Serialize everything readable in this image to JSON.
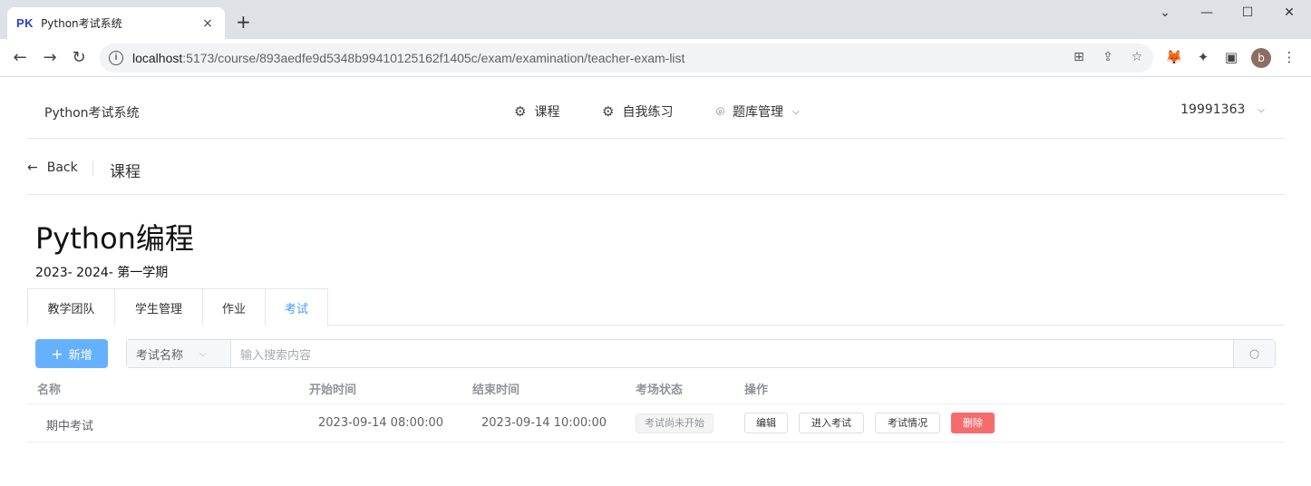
{
  "browser": {
    "tab_favicon": "PK",
    "tab_title": "Python考试系统",
    "tab_close": "×",
    "new_tab": "+",
    "url_host": "localhost",
    "url_path": ":5173/course/893aedfe9d5348b99410125162f1405c/exam/examination/teacher-exam-list",
    "profile_initial": "b"
  },
  "header": {
    "brand": "Python考试系统",
    "nav": [
      {
        "label": "课程",
        "icon": "gear-icon"
      },
      {
        "label": "自我练习",
        "icon": "gear-icon"
      },
      {
        "label": "题库管理",
        "icon": "location-pin-icon"
      }
    ],
    "user": "19991363"
  },
  "page_header": {
    "back_label": "Back",
    "title": "课程"
  },
  "course": {
    "title": "Python编程",
    "semester": "2023- 2024- 第一学期"
  },
  "tabs": [
    {
      "label": "教学团队",
      "active": false
    },
    {
      "label": "学生管理",
      "active": false
    },
    {
      "label": "作业",
      "active": false
    },
    {
      "label": "考试",
      "active": true
    }
  ],
  "toolbar": {
    "add_label": "新增",
    "filter_selected": "考试名称",
    "search_placeholder": "输入搜索内容"
  },
  "table": {
    "columns": [
      "名称",
      "开始时间",
      "结束时间",
      "考场状态",
      "操作"
    ],
    "rows": [
      {
        "name": "期中考试",
        "start": "2023-09-14 08:00:00",
        "end": "2023-09-14 10:00:00",
        "status": "考试尚未开始",
        "actions": [
          "编辑",
          "进入考试",
          "考试情况",
          "删除"
        ]
      }
    ]
  },
  "colors": {
    "primary": "#409eff",
    "add_button": "#66b1ff",
    "danger": "#f56c6c"
  }
}
